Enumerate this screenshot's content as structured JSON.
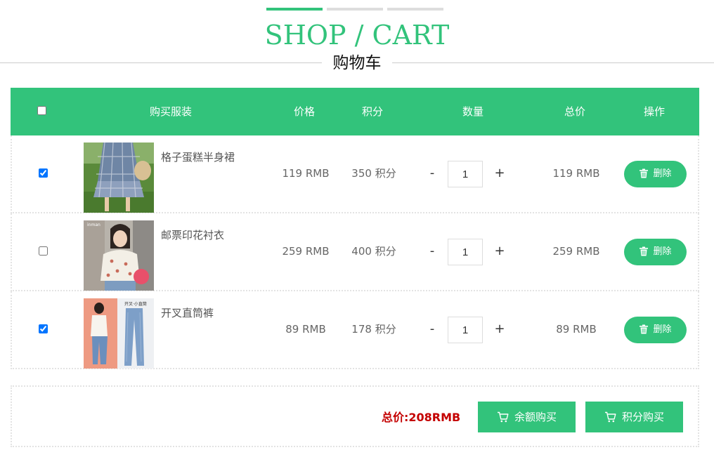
{
  "header": {
    "title_en": "SHOP / CART",
    "title_cn": "购物车",
    "progress_steps": [
      true,
      false,
      false
    ]
  },
  "table": {
    "columns": {
      "item": "购买服装",
      "price": "价格",
      "points": "积分",
      "quantity": "数量",
      "total": "总价",
      "action": "操作"
    },
    "rows": [
      {
        "checked": true,
        "name": "格子蛋糕半身裙",
        "price": "119 RMB",
        "points": "350 积分",
        "qty": "1",
        "total": "119 RMB",
        "delete": "删除",
        "minus": "-",
        "plus": "+"
      },
      {
        "checked": false,
        "name": "邮票印花衬衣",
        "price": "259 RMB",
        "points": "400 积分",
        "qty": "1",
        "total": "259 RMB",
        "delete": "删除",
        "minus": "-",
        "plus": "+"
      },
      {
        "checked": true,
        "name": "开叉直筒裤",
        "price": "89 RMB",
        "points": "178 积分",
        "qty": "1",
        "total": "89 RMB",
        "delete": "删除",
        "minus": "-",
        "plus": "+"
      }
    ]
  },
  "footer": {
    "total_label": "总价:208RMB",
    "buy_balance": "余额购买",
    "buy_points": "积分购买"
  },
  "colors": {
    "accent": "#32c37b",
    "total_red": "#c40000"
  }
}
